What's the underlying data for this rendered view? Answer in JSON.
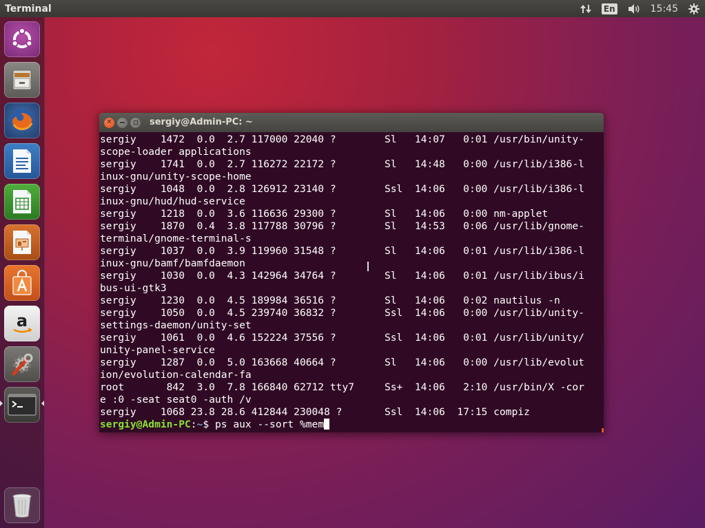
{
  "top_panel": {
    "app_title": "Terminal",
    "indicators": {
      "network_icon": "network-updown-icon",
      "language": "En",
      "sound_icon": "volume-icon",
      "clock": "15:45",
      "settings_icon": "gear-icon"
    }
  },
  "launcher": {
    "items": [
      {
        "name": "dash-home",
        "icon": "ubuntu-logo-icon"
      },
      {
        "name": "files",
        "icon": "file-cabinet-icon"
      },
      {
        "name": "firefox",
        "icon": "firefox-icon"
      },
      {
        "name": "libreoffice-writer",
        "icon": "writer-icon"
      },
      {
        "name": "libreoffice-calc",
        "icon": "calc-icon"
      },
      {
        "name": "libreoffice-impress",
        "icon": "impress-icon"
      },
      {
        "name": "ubuntu-software",
        "icon": "shopping-bag-icon"
      },
      {
        "name": "amazon",
        "icon": "amazon-icon"
      },
      {
        "name": "system-settings",
        "icon": "settings-wrench-icon"
      },
      {
        "name": "terminal",
        "icon": "terminal-icon"
      },
      {
        "name": "trash",
        "icon": "trash-icon"
      }
    ]
  },
  "terminal": {
    "title": "sergiy@Admin-PC: ~",
    "colors": {
      "background": "#300a24",
      "foreground": "#ffffff",
      "prompt_user": "#8ae234",
      "prompt_path": "#729fcf",
      "accent": "#e95420"
    },
    "lines": [
      "sergiy    1472  0.0  2.7 117000 22040 ?        Sl   14:07   0:01 /usr/bin/unity-",
      "scope-loader applications",
      "sergiy    1741  0.0  2.7 116272 22172 ?        Sl   14:48   0:00 /usr/lib/i386-l",
      "inux-gnu/unity-scope-home",
      "sergiy    1048  0.0  2.8 126912 23140 ?        Ssl  14:06   0:00 /usr/lib/i386-l",
      "inux-gnu/hud/hud-service",
      "sergiy    1218  0.0  3.6 116636 29300 ?        Sl   14:06   0:00 nm-applet",
      "sergiy    1870  0.4  3.8 117788 30796 ?        Sl   14:53   0:06 /usr/lib/gnome-",
      "terminal/gnome-terminal-s",
      "sergiy    1037  0.0  3.9 119960 31548 ?        Sl   14:06   0:01 /usr/lib/i386-l",
      "inux-gnu/bamf/bamfdaemon",
      "sergiy    1030  0.0  4.3 142964 34764 ?        Sl   14:06   0:01 /usr/lib/ibus/i",
      "bus-ui-gtk3",
      "sergiy    1230  0.0  4.5 189984 36516 ?        Sl   14:06   0:02 nautilus -n",
      "sergiy    1050  0.0  4.5 239740 36832 ?        Ssl  14:06   0:00 /usr/lib/unity-",
      "settings-daemon/unity-set",
      "sergiy    1061  0.0  4.6 152224 37556 ?        Ssl  14:06   0:01 /usr/lib/unity/",
      "unity-panel-service",
      "sergiy    1287  0.0  5.0 163668 40664 ?        Sl   14:06   0:00 /usr/lib/evolut",
      "ion/evolution-calendar-fa",
      "root       842  3.0  7.8 166840 62712 tty7     Ss+  14:06   2:10 /usr/bin/X -cor",
      "e :0 -seat seat0 -auth /v",
      "sergiy    1068 23.8 28.6 412844 230048 ?       Ssl  14:06  17:15 compiz"
    ],
    "prompt": {
      "user_host": "sergiy@Admin-PC",
      "separator": ":",
      "path": "~",
      "symbol": "$ ",
      "command": "ps aux --sort %mem"
    }
  }
}
